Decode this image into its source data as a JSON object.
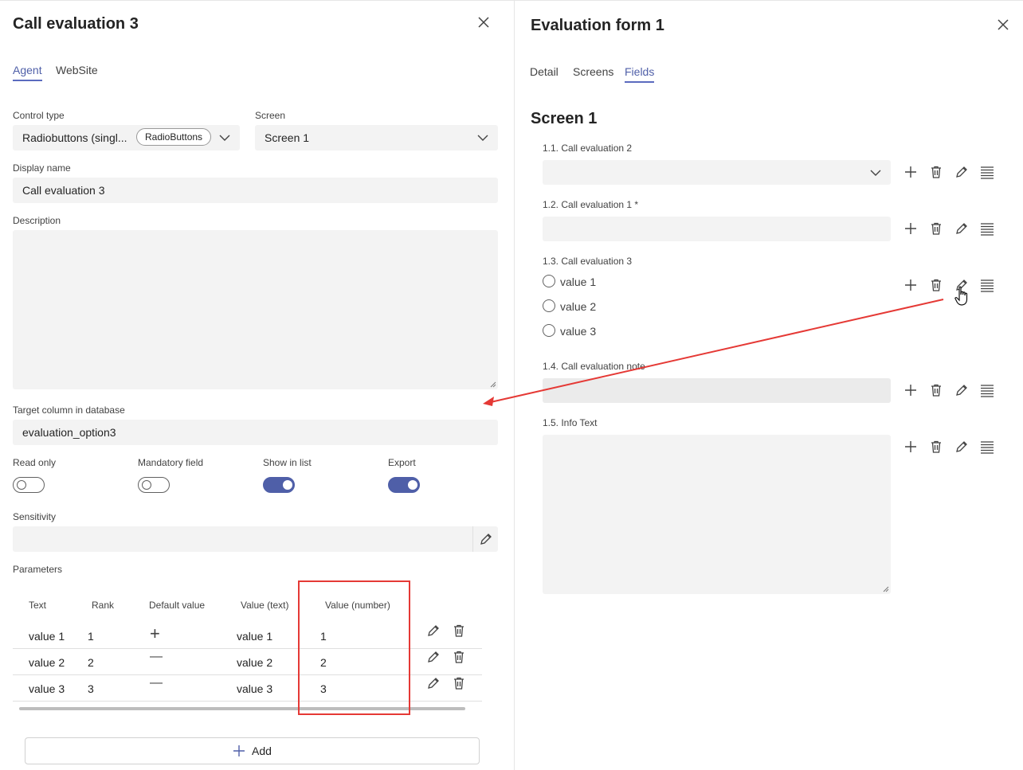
{
  "left_panel": {
    "title": "Call evaluation 3",
    "tabs": [
      {
        "label": "Agent",
        "active": true
      },
      {
        "label": "WebSite",
        "active": false
      }
    ],
    "control_type": {
      "label": "Control type",
      "value": "Radiobuttons (singl...",
      "badge": "RadioButtons"
    },
    "screen": {
      "label": "Screen",
      "value": "Screen 1"
    },
    "display_name": {
      "label": "Display name",
      "value": "Call evaluation 3"
    },
    "description": {
      "label": "Description",
      "value": ""
    },
    "target_column": {
      "label": "Target column in database",
      "value": "evaluation_option3"
    },
    "toggles": [
      {
        "label": "Read only",
        "on": false
      },
      {
        "label": "Mandatory field",
        "on": false
      },
      {
        "label": "Show in list",
        "on": true
      },
      {
        "label": "Export",
        "on": true
      }
    ],
    "sensitivity": {
      "label": "Sensitivity",
      "value": ""
    },
    "parameters": {
      "label": "Parameters",
      "columns": [
        "Text",
        "Rank",
        "Default value",
        "Value (text)",
        "Value (number)"
      ],
      "rows": [
        {
          "text": "value 1",
          "rank": "1",
          "default": "+",
          "value_text": "value 1",
          "value_number": "1"
        },
        {
          "text": "value 2",
          "rank": "2",
          "default": "—",
          "value_text": "value 2",
          "value_number": "2"
        },
        {
          "text": "value 3",
          "rank": "3",
          "default": "—",
          "value_text": "value 3",
          "value_number": "3"
        }
      ]
    },
    "add_label": "Add"
  },
  "right_panel": {
    "title": "Evaluation form 1",
    "tabs": [
      {
        "label": "Detail",
        "active": false
      },
      {
        "label": "Screens",
        "active": false
      },
      {
        "label": "Fields",
        "active": true
      }
    ],
    "screen_heading": "Screen 1",
    "fields": [
      {
        "label": "1.1. Call evaluation 2",
        "kind": "dropdown"
      },
      {
        "label": "1.2. Call evaluation 1 *",
        "kind": "text"
      },
      {
        "label": "1.3. Call evaluation 3",
        "kind": "radio",
        "options": [
          "value 1",
          "value 2",
          "value 3"
        ]
      },
      {
        "label": "1.4. Call evaluation note",
        "kind": "text-disabled"
      },
      {
        "label": "1.5. Info Text",
        "kind": "textarea"
      }
    ]
  },
  "colors": {
    "accent": "#4f5fa8",
    "highlight_box": "#e53935",
    "arrow": "#e53935",
    "field_bg": "#f3f3f3"
  },
  "icons": [
    "close-icon",
    "chevron-down-icon",
    "pencil-icon",
    "trash-icon",
    "plus-icon",
    "drag-lines-icon",
    "hand-cursor-icon"
  ]
}
